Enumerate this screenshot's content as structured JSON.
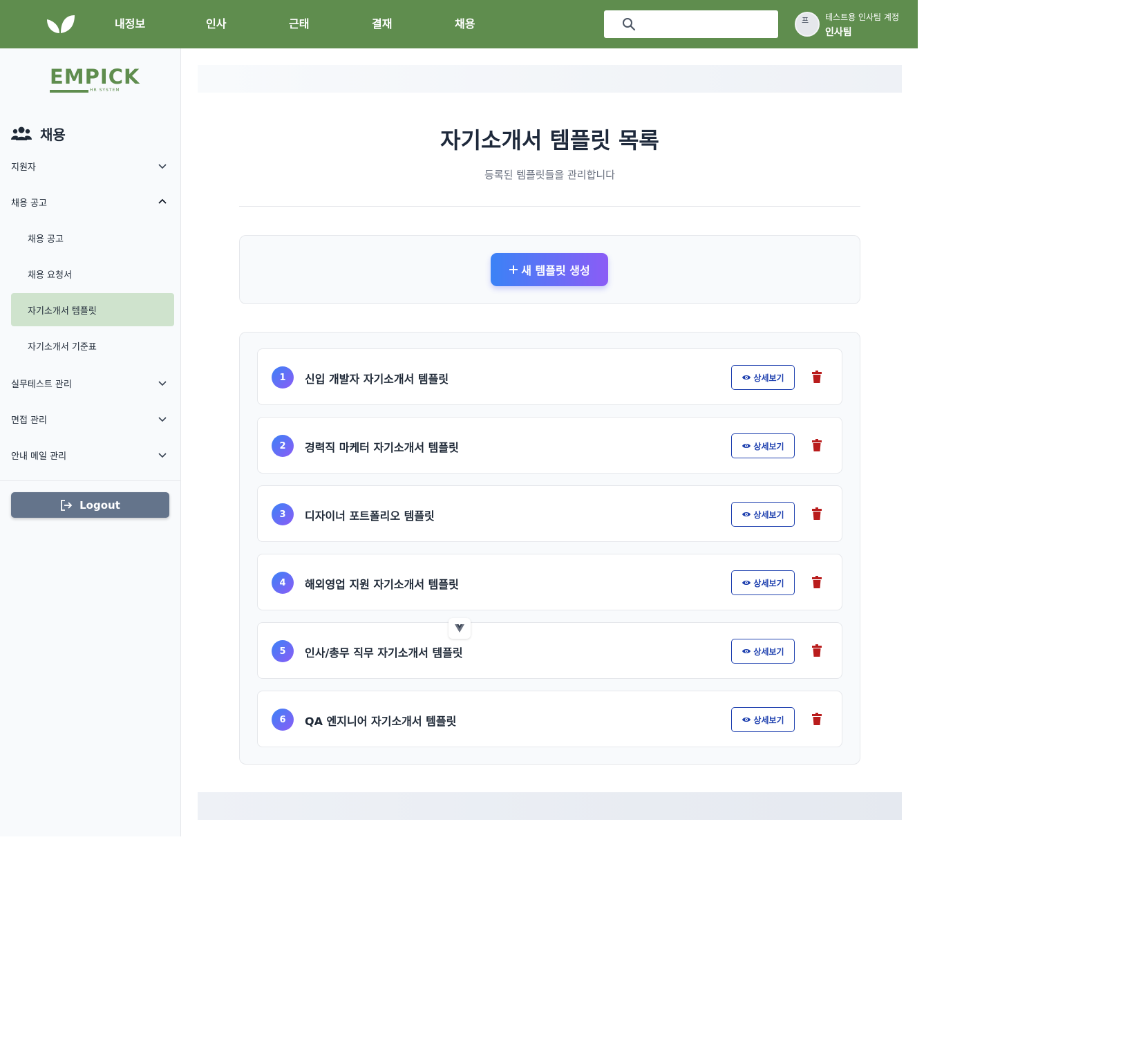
{
  "colors": {
    "brand_green": "#5f8d4e",
    "active_bg": "#cfe3cd",
    "accent_blue": "#3b82f6",
    "accent_purple": "#8b5cf6",
    "danger_red": "#b91c1c",
    "logout_gray": "#64748b"
  },
  "topbar": {
    "logo_icon": "leaf-icon",
    "nav": [
      {
        "label": "내정보"
      },
      {
        "label": "인사"
      },
      {
        "label": "근태"
      },
      {
        "label": "결재"
      },
      {
        "label": "채용"
      }
    ],
    "search": {
      "icon": "search-icon",
      "placeholder": "",
      "value": ""
    },
    "user": {
      "avatar_alt": "프",
      "name": "테스트용 인사팀 계정",
      "team": "인사팀"
    }
  },
  "sidebar": {
    "brand": {
      "name": "EMPICK",
      "sub": "HR SYSTEM"
    },
    "section": {
      "icon": "users-icon",
      "label": "채용"
    },
    "menu": [
      {
        "label": "지원자",
        "expanded": false
      },
      {
        "label": "채용 공고",
        "expanded": true,
        "children": [
          {
            "label": "채용 공고",
            "active": false
          },
          {
            "label": "채용 요청서",
            "active": false
          },
          {
            "label": "자기소개서 템플릿",
            "active": true
          },
          {
            "label": "자기소개서 기준표",
            "active": false
          }
        ]
      },
      {
        "label": "실무테스트 관리",
        "expanded": false
      },
      {
        "label": "면접 관리",
        "expanded": false
      },
      {
        "label": "안내 메일 관리",
        "expanded": false
      }
    ],
    "logout_label": "Logout"
  },
  "main": {
    "title": "자기소개서 템플릿 목록",
    "subtitle": "등록된 템플릿들을 관리합니다",
    "create_button": "새 템플릿 생성",
    "view_label": "상세보기",
    "templates": [
      {
        "number": "1",
        "name": "신입 개발자 자기소개서 템플릿"
      },
      {
        "number": "2",
        "name": "경력직 마케터 자기소개서 템플릿"
      },
      {
        "number": "3",
        "name": "디자이너 포트폴리오 템플릿"
      },
      {
        "number": "4",
        "name": "해외영업 지원 자기소개서 템플릿"
      },
      {
        "number": "5",
        "name": "인사/총무 직무 자기소개서 템플릿"
      },
      {
        "number": "6",
        "name": "QA 엔지니어 자기소개서 템플릿"
      }
    ]
  }
}
